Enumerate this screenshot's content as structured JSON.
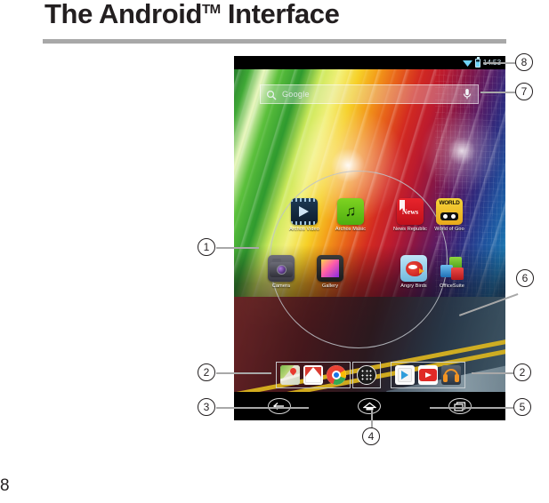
{
  "document": {
    "title": "The Android",
    "title_sup": "TM",
    "title_suffix": " Interface",
    "page_number": "8"
  },
  "device": {
    "statusbar": {
      "wifi_icon": "wifi-icon",
      "battery_icon": "battery-icon",
      "time": "14:53"
    },
    "search": {
      "search_icon": "search-icon",
      "label": "Google",
      "mic_icon": "microphone-icon"
    },
    "apps": [
      {
        "label": "Archos Video",
        "icon": "archos-video-icon",
        "row": 0,
        "col": 1
      },
      {
        "label": "Archos Music",
        "icon": "archos-music-icon",
        "row": 0,
        "col": 2
      },
      {
        "label": "News Republic",
        "icon": "news-republic-icon",
        "row": 0,
        "col": 4
      },
      {
        "label": "World of Goo",
        "icon": "world-of-goo-icon",
        "row": 0,
        "col": 5
      },
      {
        "label": "Camera",
        "icon": "camera-icon",
        "row": 1,
        "col": 0
      },
      {
        "label": "Gallery",
        "icon": "gallery-icon",
        "row": 1,
        "col": 1
      },
      {
        "label": "Angry Birds",
        "icon": "angry-birds-icon",
        "row": 1,
        "col": 4
      },
      {
        "label": "OfficeSuite",
        "icon": "officesuite-icon",
        "row": 1,
        "col": 5
      }
    ],
    "dock": {
      "left": [
        {
          "name": "maps-icon"
        },
        {
          "name": "gmail-icon"
        },
        {
          "name": "chrome-icon"
        }
      ],
      "center": {
        "name": "all-apps-icon"
      },
      "right": [
        {
          "name": "play-store-icon"
        },
        {
          "name": "youtube-icon"
        },
        {
          "name": "play-music-icon"
        }
      ]
    },
    "navbar": [
      {
        "name": "back-button"
      },
      {
        "name": "home-button"
      },
      {
        "name": "recent-apps-button"
      }
    ]
  },
  "callouts": [
    {
      "number": "1",
      "target": "home-screen-widgets-area"
    },
    {
      "number": "2",
      "target": "dock-left-shortcuts"
    },
    {
      "number": "3",
      "target": "back-button"
    },
    {
      "number": "4",
      "target": "home-button"
    },
    {
      "number": "5",
      "target": "recent-apps-button"
    },
    {
      "number": "6",
      "target": "app-shortcuts-area"
    },
    {
      "number": "7",
      "target": "google-search-bar"
    },
    {
      "number": "8",
      "target": "status-bar"
    },
    {
      "number": "2",
      "target": "dock-right-shortcuts"
    }
  ],
  "colors": {
    "rule": "#a8a8a8",
    "ink": "#231f20",
    "leader": "#a8a8a8"
  }
}
